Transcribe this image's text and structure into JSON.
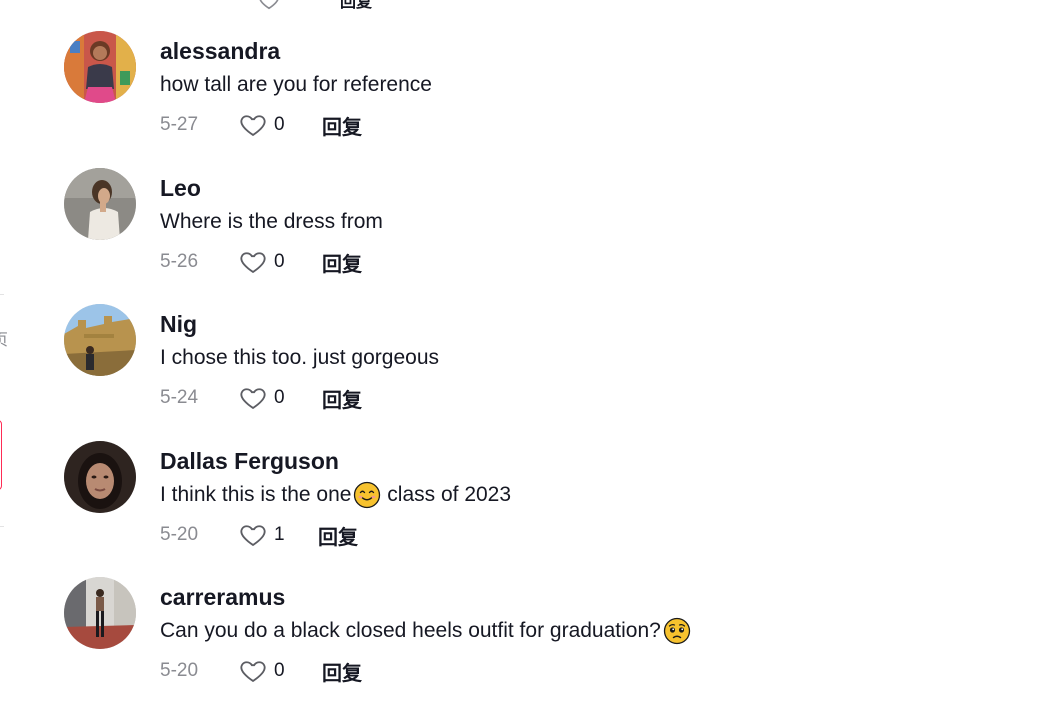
{
  "top_peek": {
    "label": "回复"
  },
  "sidebar_fragment": {
    "char": "页"
  },
  "comments": [
    {
      "username": "alessandra",
      "text": "how tall are you for reference",
      "emoji": "",
      "date": "5-27",
      "likes": "0",
      "reply_label": "回复"
    },
    {
      "username": "Leo",
      "text": "Where is the dress from",
      "emoji": "",
      "date": "5-26",
      "likes": "0",
      "reply_label": "回复"
    },
    {
      "username": "Nig",
      "text": "I chose this too. just gorgeous",
      "emoji": "",
      "date": "5-24",
      "likes": "0",
      "reply_label": "回复"
    },
    {
      "username": "Dallas Ferguson",
      "text": "I think this is the one",
      "emoji": "smiling-face-emoji",
      "text_after": " class of 2023",
      "date": "5-20",
      "likes": "1",
      "reply_label": "回复"
    },
    {
      "username": "carreramus",
      "text": "Can you do a black closed heels outfit for graduation?",
      "emoji": "pleading-face-emoji",
      "date": "5-20",
      "likes": "0",
      "reply_label": "回复"
    }
  ],
  "colors": {
    "text_primary": "#161823",
    "text_secondary": "#8a8b91",
    "accent": "#fe2c55",
    "emoji_yellow": "#f7c22e"
  }
}
